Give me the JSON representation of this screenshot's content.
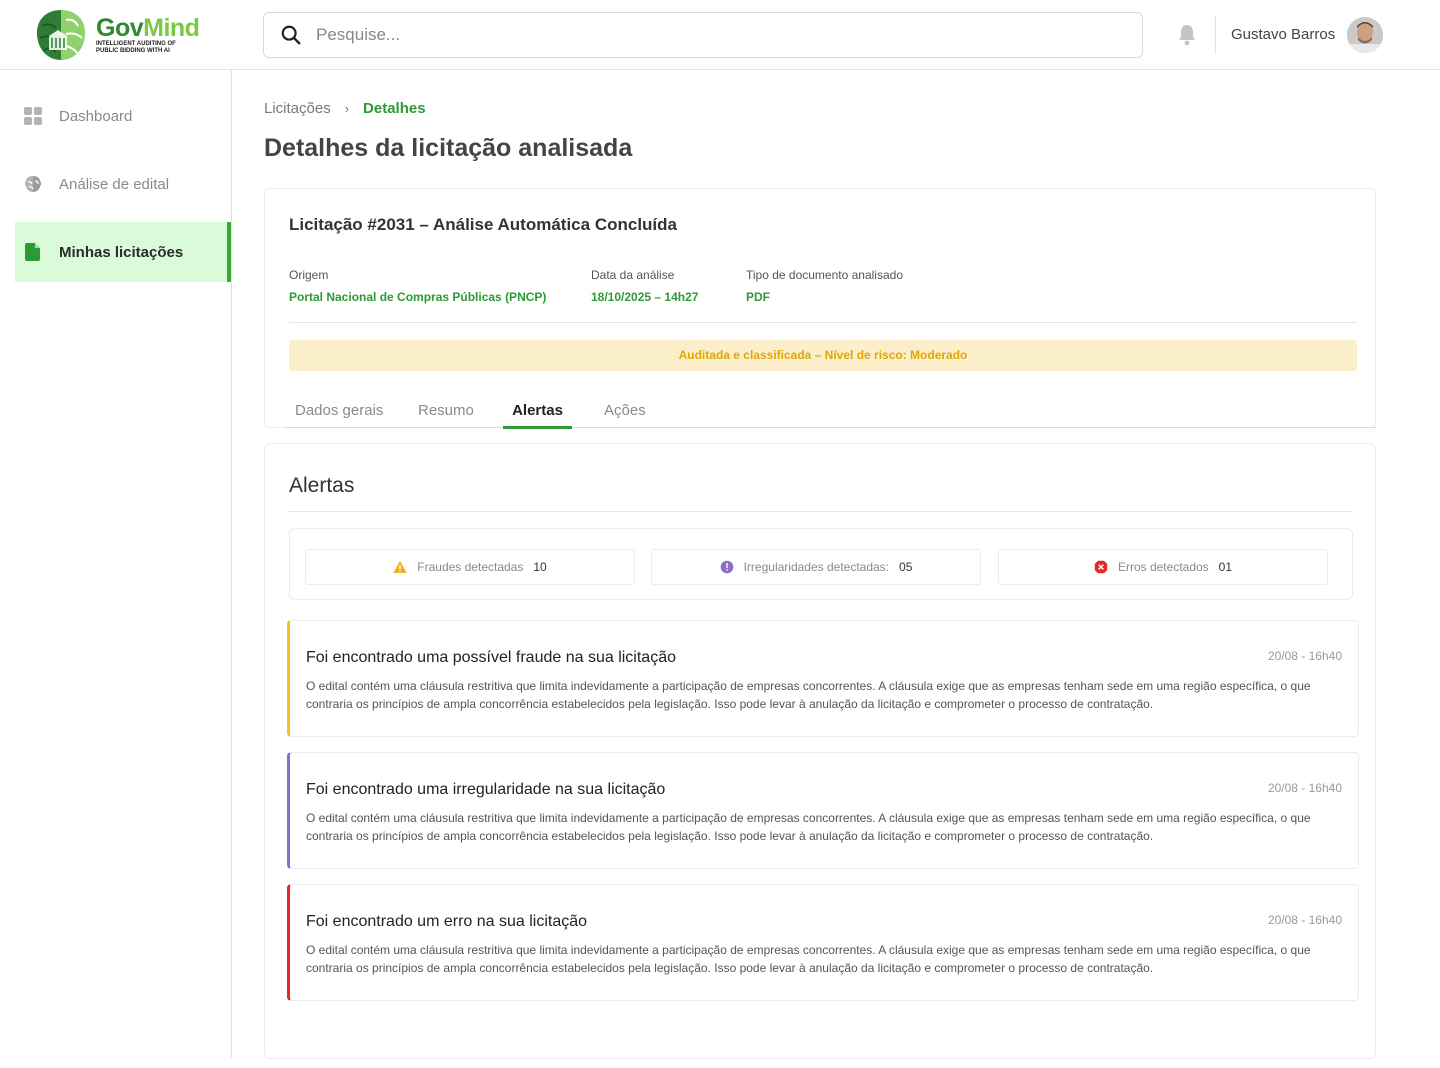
{
  "brand": {
    "name_part1": "Gov",
    "name_part2": "Mind",
    "tagline": "INTELLIGENT AUDITING OF PUBLIC BIDDING WITH AI",
    "primary_color": "#2e9a33",
    "accent_color": "#7ac943"
  },
  "header": {
    "search_placeholder": "Pesquise...",
    "user_name": "Gustavo Barros",
    "icons": [
      "search-icon",
      "bell-icon"
    ]
  },
  "sidebar": {
    "items": [
      {
        "label": "Dashboard",
        "icon": "grid-icon",
        "active": false
      },
      {
        "label": "Análise de edital",
        "icon": "brain-icon",
        "active": false
      },
      {
        "label": "Minhas licitações",
        "icon": "document-icon",
        "active": true
      }
    ]
  },
  "breadcrumb": {
    "parent": "Licitações",
    "separator": "›",
    "current": "Detalhes"
  },
  "page_title": "Detalhes da licitação analisada",
  "summary": {
    "title": "Licitação #2031 – Análise Automática Concluída",
    "meta": [
      {
        "label": "Origem",
        "value": "Portal Nacional de Compras Públicas (PNCP)"
      },
      {
        "label": "Data da análise",
        "value": "18/10/2025 – 14h27"
      },
      {
        "label": "Tipo de documento analisado",
        "value": "PDF"
      }
    ],
    "risk_banner": "Auditada e classificada – Nível de risco: Moderado",
    "risk_color": "#e0a800"
  },
  "tabs": [
    {
      "label": "Dados gerais",
      "active": false
    },
    {
      "label": "Resumo",
      "active": false
    },
    {
      "label": "Alertas",
      "active": true
    },
    {
      "label": "Ações",
      "active": false
    }
  ],
  "alerts_section": {
    "title": "Alertas",
    "stats": [
      {
        "label": "Fraudes detectadas",
        "count": "10",
        "icon": "warning-icon",
        "color": "#f2b01e"
      },
      {
        "label": "Irregularidades detectadas:",
        "count": "05",
        "icon": "info-icon",
        "color": "#8c6ec6"
      },
      {
        "label": "Erros detectados",
        "count": "01",
        "icon": "error-icon",
        "color": "#e5252a"
      }
    ],
    "items": [
      {
        "title": "Foi encontrado uma possível fraude na sua licitação",
        "time": "20/08 - 16h40",
        "text": "O edital contém uma cláusula restritiva que limita indevidamente a participação de empresas concorrentes. A cláusula exige que as empresas tenham sede em uma região específica, o que contraria os princípios de ampla concorrência estabelecidos pela legislação. Isso pode levar à anulação da licitação e comprometer o processo de contratação.",
        "color": "#f2c12e"
      },
      {
        "title": "Foi encontrado uma irregularidade na sua licitação",
        "time": "20/08 - 16h40",
        "text": "O edital contém uma cláusula restritiva que limita indevidamente a participação de empresas concorrentes. A cláusula exige que as empresas tenham sede em uma região específica, o que contraria os princípios de ampla concorrência estabelecidos pela legislação. Isso pode levar à anulação da licitação e comprometer o processo de contratação.",
        "color": "#8c6ec6"
      },
      {
        "title": "Foi encontrado um erro na sua licitação",
        "time": "20/08 - 16h40",
        "text": "O edital contém uma cláusula restritiva que limita indevidamente a participação de empresas concorrentes. A cláusula exige que as empresas tenham sede em uma região específica, o que contraria os princípios de ampla concorrência estabelecidos pela legislação. Isso pode levar à anulação da licitação e comprometer o processo de contratação.",
        "color": "#e5252a"
      }
    ]
  }
}
